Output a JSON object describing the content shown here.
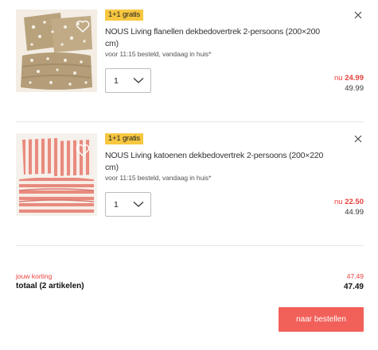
{
  "cart": {
    "items": [
      {
        "badge": "1+1 gratis",
        "title": "NOUS Living flanellen dekbedovertrek 2-persoons (200×200 cm)",
        "delivery": "voor 11:15 besteld, vandaag in huis*",
        "quantity": "1",
        "price_prefix": "nu",
        "price_new": "24.99",
        "price_old": "49.99",
        "image": "beige-flannel-duvet-cover-with-white-floral-print"
      },
      {
        "badge": "1+1 gratis",
        "title": "NOUS Living katoenen dekbedovertrek 2-persoons (200×220 cm)",
        "delivery": "voor 11:15 besteld, vandaag in huis*",
        "quantity": "1",
        "price_prefix": "nu",
        "price_new": "22.50",
        "price_old": "44.99",
        "image": "pink-and-white-striped-cotton-duvet-cover"
      }
    ]
  },
  "summary": {
    "discount_label": "jouw korting",
    "discount_value": "47.49",
    "total_label": "totaal (2 artikelen)",
    "total_value": "47.49"
  },
  "actions": {
    "checkout_label": "naar bestellen"
  },
  "colors": {
    "accent": "#f2605a",
    "price_red": "#e8413b",
    "badge_yellow": "#f7c740"
  }
}
